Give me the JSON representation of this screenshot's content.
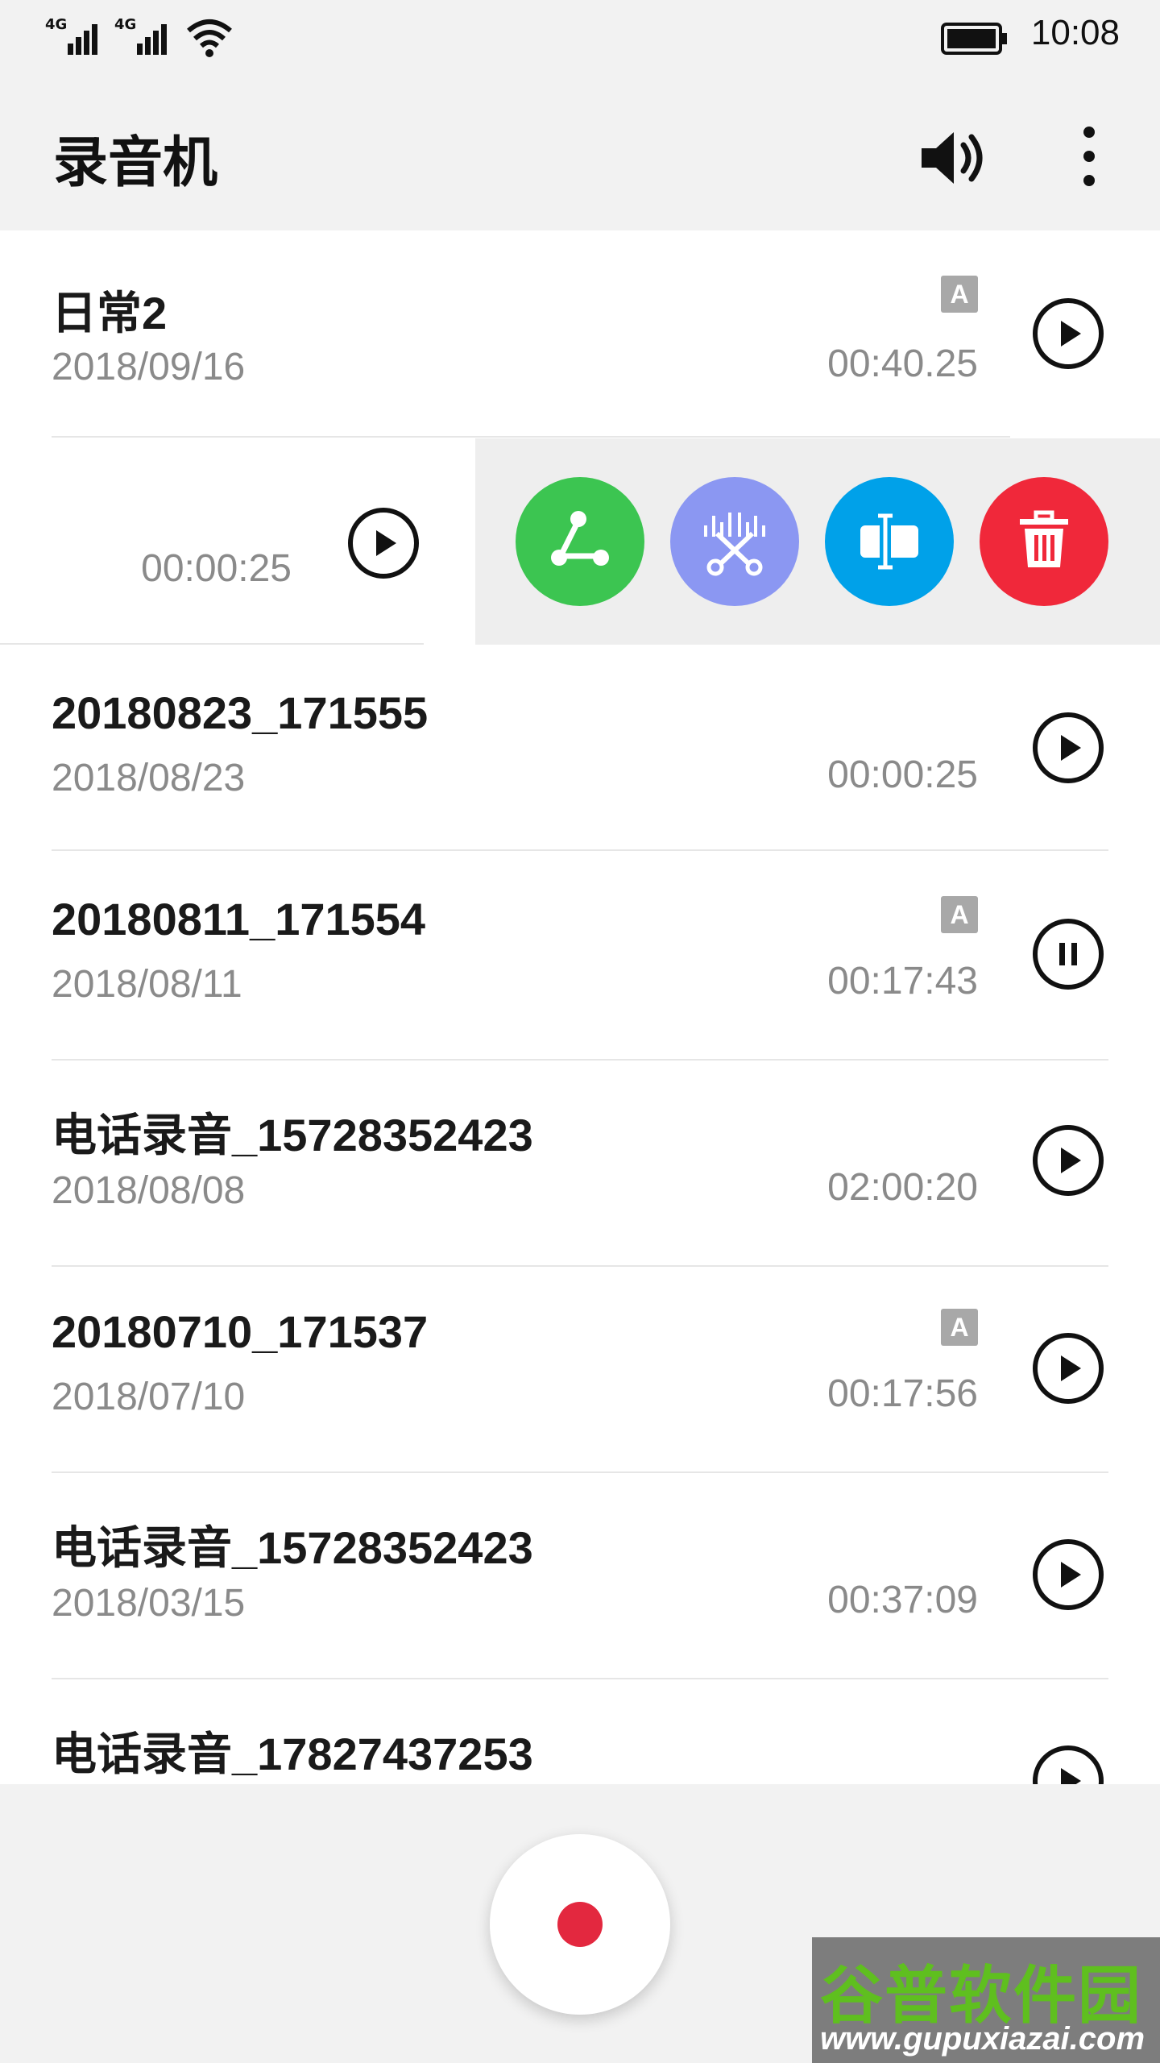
{
  "status_bar": {
    "sim1_label": "4G",
    "sim2_label": "4G",
    "time": "10:08",
    "icons": [
      "signal-icon",
      "signal-icon",
      "wifi-icon",
      "battery-icon"
    ]
  },
  "app_bar": {
    "title": "录音机",
    "actions": [
      "speaker-icon",
      "more-vertical-icon"
    ]
  },
  "recordings": [
    {
      "name": "日常2",
      "date": "2018/09/16",
      "duration": "00:40.25",
      "badge": "A",
      "state": "play"
    },
    {
      "name": "",
      "date": "",
      "duration": "00:00:25",
      "badge": "",
      "state": "play",
      "swiped": true
    },
    {
      "name": "20180823_171555",
      "date": "2018/08/23",
      "duration": "00:00:25",
      "badge": "",
      "state": "play"
    },
    {
      "name": "20180811_171554",
      "date": "2018/08/11",
      "duration": "00:17:43",
      "badge": "A",
      "state": "pause"
    },
    {
      "name": "电话录音_15728352423",
      "date": "2018/08/08",
      "duration": "02:00:20",
      "badge": "",
      "state": "play"
    },
    {
      "name": "20180710_171537",
      "date": "2018/07/10",
      "duration": "00:17:56",
      "badge": "A",
      "state": "play"
    },
    {
      "name": "电话录音_15728352423",
      "date": "2018/03/15",
      "duration": "00:37:09",
      "badge": "",
      "state": "play"
    },
    {
      "name": "电话录音_17827437253",
      "date": "",
      "duration": "",
      "badge": "",
      "state": "play"
    }
  ],
  "swipe_actions": [
    {
      "icon": "share-icon",
      "color": "#3cc551"
    },
    {
      "icon": "trim-icon",
      "color": "#8b97f2"
    },
    {
      "icon": "rename-icon",
      "color": "#00a1e9"
    },
    {
      "icon": "delete-icon",
      "color": "#f0283a"
    }
  ],
  "bottom": {
    "record_icon": "record-icon",
    "record_color": "#e3283f"
  },
  "watermark": {
    "main": "谷普软件园",
    "url": "www.gupuxiazai.com"
  }
}
